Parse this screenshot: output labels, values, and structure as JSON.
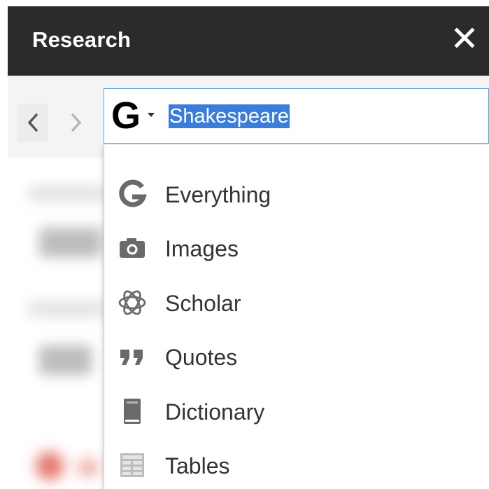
{
  "header": {
    "title": "Research",
    "close_icon": "close-icon"
  },
  "toolbar": {
    "back_icon": "chevron-left-icon",
    "forward_icon": "chevron-right-icon"
  },
  "search": {
    "engine_letter": "G",
    "query": "Shakespeare"
  },
  "menu": {
    "items": [
      {
        "label": "Everything",
        "icon": "google-g-icon"
      },
      {
        "label": "Images",
        "icon": "camera-icon"
      },
      {
        "label": "Scholar",
        "icon": "atom-icon"
      },
      {
        "label": "Quotes",
        "icon": "quote-icon"
      },
      {
        "label": "Dictionary",
        "icon": "book-icon"
      },
      {
        "label": "Tables",
        "icon": "table-icon"
      }
    ]
  },
  "colors": {
    "header_bg": "#2b2b2b",
    "selection": "#3b7ddd",
    "focus_border": "#5b9bd5",
    "icon_gray": "#606060"
  }
}
